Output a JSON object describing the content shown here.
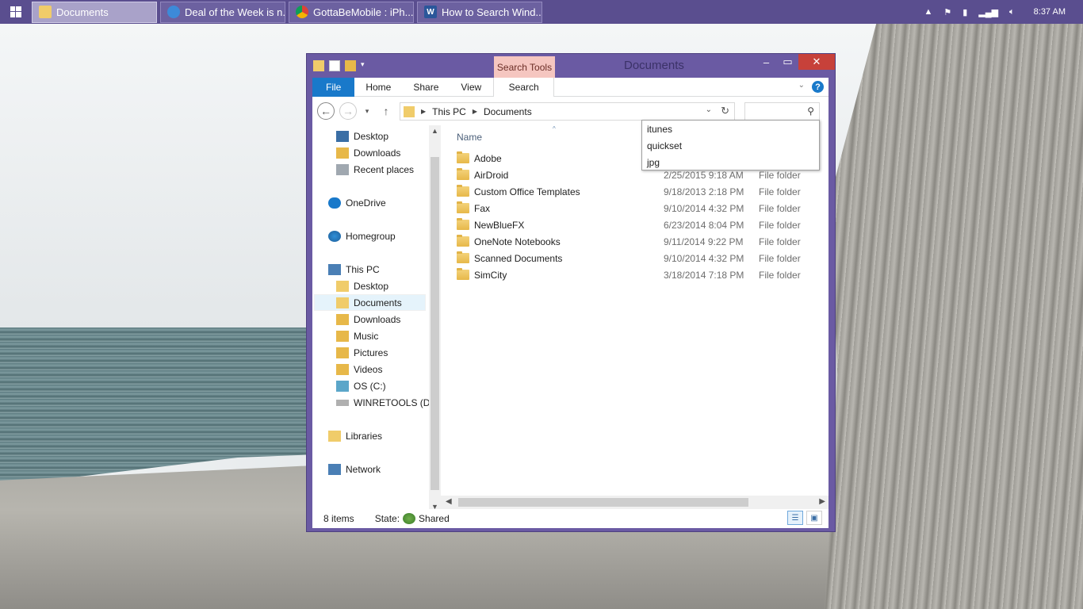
{
  "taskbar": {
    "start_icon": "windows-logo-icon",
    "buttons": [
      {
        "label": "Documents",
        "icon": "folder-icon",
        "active": true
      },
      {
        "label": "Deal of the Week is n...",
        "icon": "internet-explorer-icon"
      },
      {
        "label": "GottaBeMobile : iPh...",
        "icon": "chrome-icon"
      },
      {
        "label": "How to Search Wind...",
        "icon": "word-icon"
      }
    ],
    "tray_icons": [
      "show-hidden-icon",
      "flag-icon",
      "battery-icon",
      "signal-icon",
      "volume-icon"
    ],
    "clock": "8:37 AM"
  },
  "window": {
    "title": "Documents",
    "contextual_tab": "Search Tools",
    "ribbon_tabs": [
      "File",
      "Home",
      "Share",
      "View",
      "Search"
    ],
    "help_label": "?"
  },
  "address": {
    "crumbs": [
      "This PC",
      "Documents"
    ],
    "search_value": ""
  },
  "nav": {
    "favorites": [
      "Desktop",
      "Downloads",
      "Recent places"
    ],
    "onedrive": "OneDrive",
    "homegroup": "Homegroup",
    "this_pc": "This PC",
    "pc_items": [
      "Desktop",
      "Documents",
      "Downloads",
      "Music",
      "Pictures",
      "Videos",
      "OS (C:)",
      "WINRETOOLS (D:)"
    ],
    "libraries": "Libraries",
    "network": "Network"
  },
  "content": {
    "column_name": "Name",
    "rows": [
      {
        "name": "Adobe",
        "date": "",
        "type": ""
      },
      {
        "name": "AirDroid",
        "date": "2/25/2015 9:18 AM",
        "type": "File folder"
      },
      {
        "name": "Custom Office Templates",
        "date": "9/18/2013 2:18 PM",
        "type": "File folder"
      },
      {
        "name": "Fax",
        "date": "9/10/2014 4:32 PM",
        "type": "File folder"
      },
      {
        "name": "NewBlueFX",
        "date": "6/23/2014 8:04 PM",
        "type": "File folder"
      },
      {
        "name": "OneNote Notebooks",
        "date": "9/11/2014 9:22 PM",
        "type": "File folder"
      },
      {
        "name": "Scanned Documents",
        "date": "9/10/2014 4:32 PM",
        "type": "File folder"
      },
      {
        "name": "SimCity",
        "date": "3/18/2014 7:18 PM",
        "type": "File folder"
      }
    ]
  },
  "suggestions": [
    "itunes",
    "quickset",
    "jpg"
  ],
  "status": {
    "items": "8 items",
    "state_label": "State:",
    "state_value": "Shared"
  },
  "colors": {
    "accent": "#5a4e8f",
    "file_tab": "#1979ca",
    "search_tools": "#f5c6c0",
    "close": "#c7413a"
  }
}
